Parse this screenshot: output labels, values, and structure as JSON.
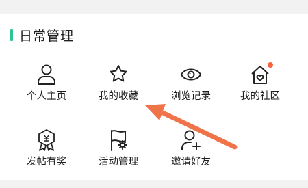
{
  "section": {
    "title": "日常管理",
    "accent_color": "#2cc693"
  },
  "items": [
    {
      "label": "个人主页",
      "icon": "user-icon"
    },
    {
      "label": "我的收藏",
      "icon": "star-icon"
    },
    {
      "label": "浏览记录",
      "icon": "eye-icon"
    },
    {
      "label": "我的社区",
      "icon": "community-home-icon",
      "badge_color": "#f5643f"
    },
    {
      "label": "发帖有奖",
      "icon": "reward-badge-icon"
    },
    {
      "label": "活动管理",
      "icon": "activity-flag-gear-icon"
    },
    {
      "label": "邀请好友",
      "icon": "add-user-icon"
    }
  ],
  "annotation": {
    "arrow_color": "#f0744a"
  }
}
